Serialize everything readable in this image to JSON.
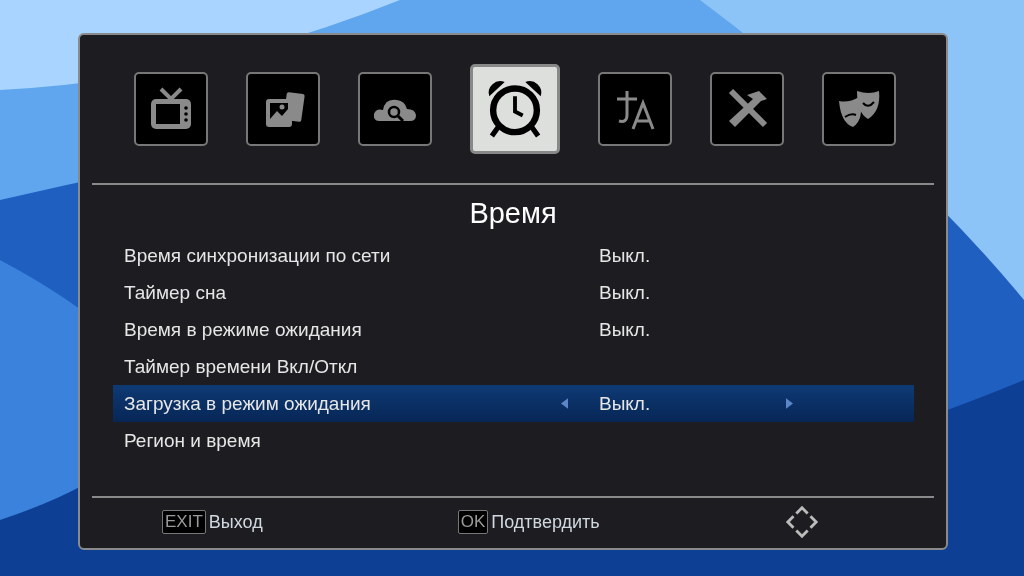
{
  "tabs": [
    {
      "kind": "tv",
      "selected": false
    },
    {
      "kind": "photos",
      "selected": false
    },
    {
      "kind": "cloud",
      "selected": false
    },
    {
      "kind": "clock",
      "selected": true
    },
    {
      "kind": "language",
      "selected": false
    },
    {
      "kind": "tools",
      "selected": false
    },
    {
      "kind": "masks",
      "selected": false
    }
  ],
  "title": "Время",
  "rows": [
    {
      "label": "Время синхронизации по сети",
      "value": "Выкл.",
      "selected": false
    },
    {
      "label": "Таймер сна",
      "value": "Выкл.",
      "selected": false
    },
    {
      "label": "Время в режиме ожидания",
      "value": "Выкл.",
      "selected": false
    },
    {
      "label": "Таймер времени Вкл/Откл",
      "selected": false
    },
    {
      "label": "Загрузка в режим ожидания",
      "value": "Выкл.",
      "selected": true
    },
    {
      "label": "Регион и время",
      "selected": false
    }
  ],
  "footer": [
    {
      "key": "EXIT",
      "label": "Выход"
    },
    {
      "key": "OK",
      "label": "Подтвердить"
    }
  ]
}
